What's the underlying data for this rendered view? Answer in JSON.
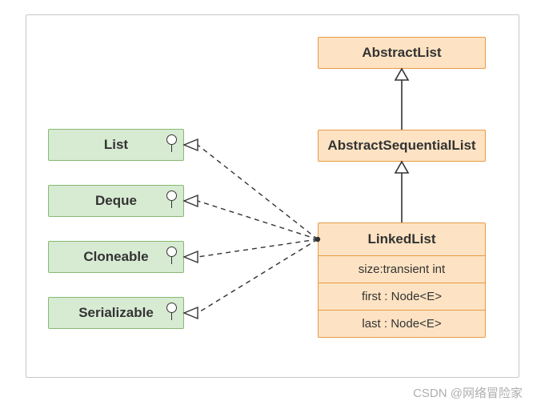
{
  "classes": {
    "abstractList": "AbstractList",
    "abstractSequentialList": "AbstractSequentialList",
    "linkedList": {
      "name": "LinkedList",
      "fields": [
        "size:transient int",
        "first : Node<E>",
        "last : Node<E>"
      ]
    }
  },
  "interfaces": [
    "List",
    "Deque",
    "Cloneable",
    "Serializable"
  ],
  "watermark": "CSDN @网络冒险家"
}
